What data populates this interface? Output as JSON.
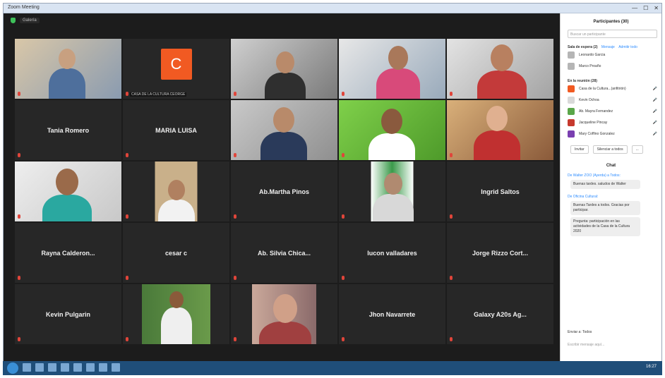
{
  "window": {
    "title": "Zoom Meeting",
    "buttons": [
      "—",
      "☐",
      "✕"
    ]
  },
  "meeting": {
    "view_label": "Galería"
  },
  "tiles": [
    {
      "display": "",
      "tag": "",
      "video": true,
      "kind": "elder"
    },
    {
      "display": "C",
      "tag": "CASA DE LA CULTURA CEORGE",
      "video": false,
      "kind": "logo"
    },
    {
      "display": "",
      "tag": "",
      "video": true,
      "kind": "young-man"
    },
    {
      "display": "",
      "tag": "",
      "video": true,
      "kind": "woman-glasses"
    },
    {
      "display": "",
      "tag": "",
      "video": true,
      "kind": "woman"
    },
    {
      "display": "Tania Romero",
      "tag": "",
      "video": false
    },
    {
      "display": "MARIA LUISA",
      "tag": "",
      "video": false
    },
    {
      "display": "",
      "tag": "",
      "video": true,
      "kind": "man-suit",
      "active": true
    },
    {
      "display": "",
      "tag": "",
      "video": true,
      "kind": "man-green"
    },
    {
      "display": "",
      "tag": "",
      "video": true,
      "kind": "blonde"
    },
    {
      "display": "",
      "tag": "",
      "video": true,
      "kind": "woman-teal"
    },
    {
      "display": "",
      "tag": "",
      "video": true,
      "kind": "man-white"
    },
    {
      "display": "Ab.Martha Pinos",
      "tag": "",
      "video": false
    },
    {
      "display": "",
      "tag": "",
      "video": true,
      "kind": "man-flag"
    },
    {
      "display": "Ingrid Saltos",
      "tag": "",
      "video": false
    },
    {
      "display": "Rayna Calderon...",
      "tag": "",
      "video": false
    },
    {
      "display": "cesar c",
      "tag": "",
      "video": false
    },
    {
      "display": "Ab. Silvia Chica...",
      "tag": "",
      "video": false
    },
    {
      "display": "lucon valladares",
      "tag": "",
      "video": false
    },
    {
      "display": "Jorge Rizzo Cort...",
      "tag": "",
      "video": false
    },
    {
      "display": "Kevin Pulgarin",
      "tag": "",
      "video": false
    },
    {
      "display": "",
      "tag": "",
      "video": true,
      "kind": "woman-garden"
    },
    {
      "display": "",
      "tag": "",
      "video": true,
      "kind": "woman-close"
    },
    {
      "display": "Jhon Navarrete",
      "tag": "",
      "video": false
    },
    {
      "display": "Galaxy A20s Ag...",
      "tag": "",
      "video": false
    }
  ],
  "panel": {
    "title": "Participantes (30)",
    "search_placeholder": "Buscar un participante",
    "waiting_label": "Sala de espera (2)",
    "waiting_action": "Mensaje",
    "waiting_action2": "Admitir todo",
    "waiting": [
      {
        "name": "Leonardo Garcia",
        "color": "#b5b5b5"
      },
      {
        "name": "Marco Proaño",
        "color": "#b5b5b5"
      }
    ],
    "in_meeting_label": "En la reunión (28)",
    "participants": [
      {
        "name": "Casa de la Cultura...(anfitrión)",
        "color": "#f15a22",
        "status": "🎤"
      },
      {
        "name": "Kevin Ochoa",
        "color": "#d9d9d9",
        "status": "🎤"
      },
      {
        "name": "Ab. Mayra Fernandez",
        "color": "#5aa649",
        "status": "🎤"
      },
      {
        "name": "Jacqueline Pincay",
        "color": "#c6392d",
        "status": "🎤"
      },
      {
        "name": "Mary Coffino Gonzalez",
        "color": "#7a3fb0",
        "status": "🎤"
      }
    ],
    "buttons": [
      "Invitar",
      "Silenciar a todos",
      "..."
    ],
    "chat_title": "Chat",
    "chat": [
      {
        "from": "De Walter ZOO (Ayerda) a Todos:",
        "msg": "Buenas tardes. saludos de Walter"
      },
      {
        "from": "De Oficina Cultural:",
        "msg": "Buenas Tardes a todos. Gracias por participar."
      },
      {
        "from": "",
        "msg": "Pregunta: participación en las actividades de la Casa de la Cultura 2020"
      }
    ],
    "send_to": "Enviar a: Todos",
    "chat_placeholder": "Escribir mensaje aquí..."
  },
  "taskbar": {
    "clock": "16:27"
  }
}
